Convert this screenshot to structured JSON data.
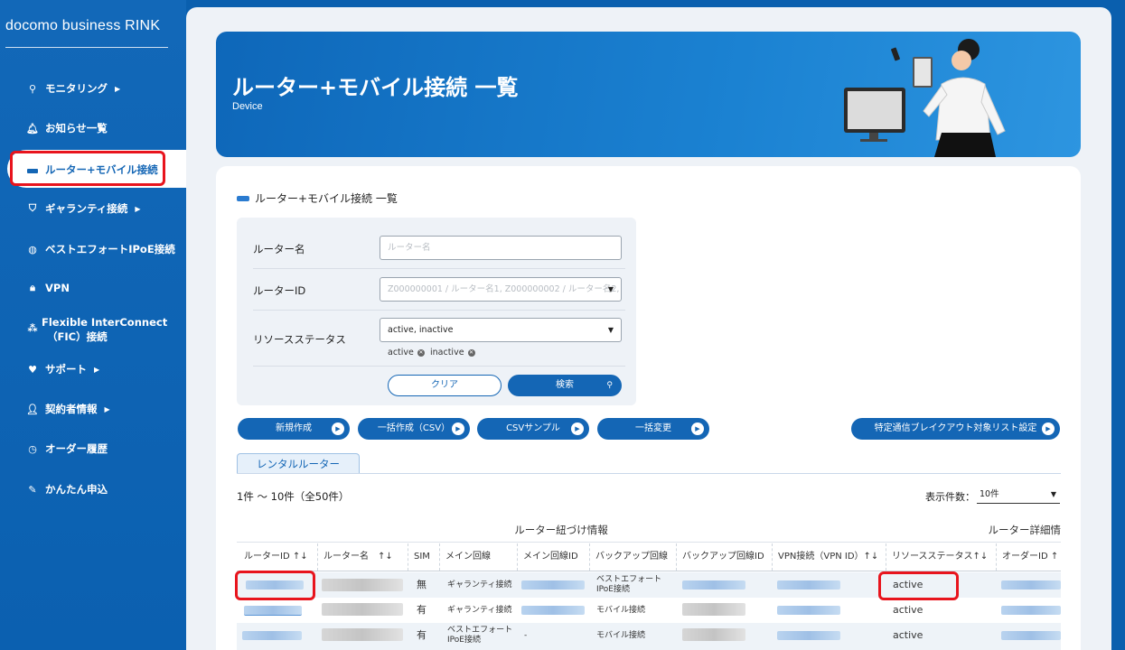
{
  "brand": "docomo business RINK",
  "nav": [
    {
      "label": "モニタリング",
      "icon": "monitoring-icon",
      "chevron": true
    },
    {
      "label": "お知らせ一覧",
      "icon": "bell-icon",
      "chevron": false
    },
    {
      "label": "ルーター+モバイル接続",
      "icon": "router-icon",
      "chevron": false,
      "active": true
    },
    {
      "label": "ギャランティ接続",
      "icon": "shield-icon",
      "chevron": true
    },
    {
      "label": "ベストエフォートIPoE接続",
      "icon": "globe-icon",
      "chevron": false
    },
    {
      "label": "VPN",
      "icon": "lock-icon",
      "chevron": false
    },
    {
      "label": "Flexible InterConnect",
      "label2": "（FIC）接続",
      "icon": "network-icon",
      "chevron": false
    },
    {
      "label": "サポート",
      "icon": "heart-hand-icon",
      "chevron": true
    },
    {
      "label": "契約者情報",
      "icon": "user-icon",
      "chevron": true
    },
    {
      "label": "オーダー履歴",
      "icon": "clock-icon",
      "chevron": false
    },
    {
      "label": "かんたん申込",
      "icon": "edit-icon",
      "chevron": false
    }
  ],
  "hero": {
    "title": "ルーター+モバイル接続 一覧",
    "subtitle": "Device"
  },
  "section_title": "ルーター+モバイル接続 一覧",
  "filter": {
    "router_name_label": "ルーター名",
    "router_name_placeholder": "ルーター名",
    "router_id_label": "ルーターID",
    "router_id_placeholder": "Z000000001 / ルーター名1, Z000000002 / ルーター名2, ...",
    "status_label": "リソースステータス",
    "status_value": "active, inactive",
    "chips": [
      "active",
      "inactive"
    ],
    "clear_label": "クリア",
    "search_label": "検索"
  },
  "actions": [
    "新規作成",
    "一括作成（CSV）",
    "CSVサンプル",
    "一括変更",
    "特定通信ブレイクアウト対象リスト設定"
  ],
  "tab_label": "レンタルルーター",
  "count_text": "1件 ～ 10件（全50件）",
  "per_page_label": "表示件数：",
  "per_page_value": "10件",
  "table": {
    "group1": "ルーター紐づけ情報",
    "group2": "ルーター詳細情",
    "headers": [
      "ルーターID ↑↓",
      "ルーター名　↑↓",
      "SIM",
      "メイン回線",
      "メイン回線ID",
      "バックアップ回線",
      "バックアップ回線ID",
      "VPN接続（VPN ID）↑↓",
      "リソースステータス↑↓",
      "オーダーID ↑"
    ],
    "rows": [
      {
        "sim": "無",
        "main": "ギャランティ接続",
        "backup": "ベストエフォート IPoE接続",
        "main_id": "",
        "status": "active"
      },
      {
        "sim": "有",
        "main": "ギャランティ接続",
        "backup": "モバイル接続",
        "main_id": "",
        "status": "active"
      },
      {
        "sim": "有",
        "main": "ベストエフォート IPoE接続",
        "backup": "モバイル接続",
        "main_id": "-",
        "status": "active"
      }
    ]
  },
  "colors": {
    "primary": "#1466b5",
    "highlight": "#e8141d"
  }
}
